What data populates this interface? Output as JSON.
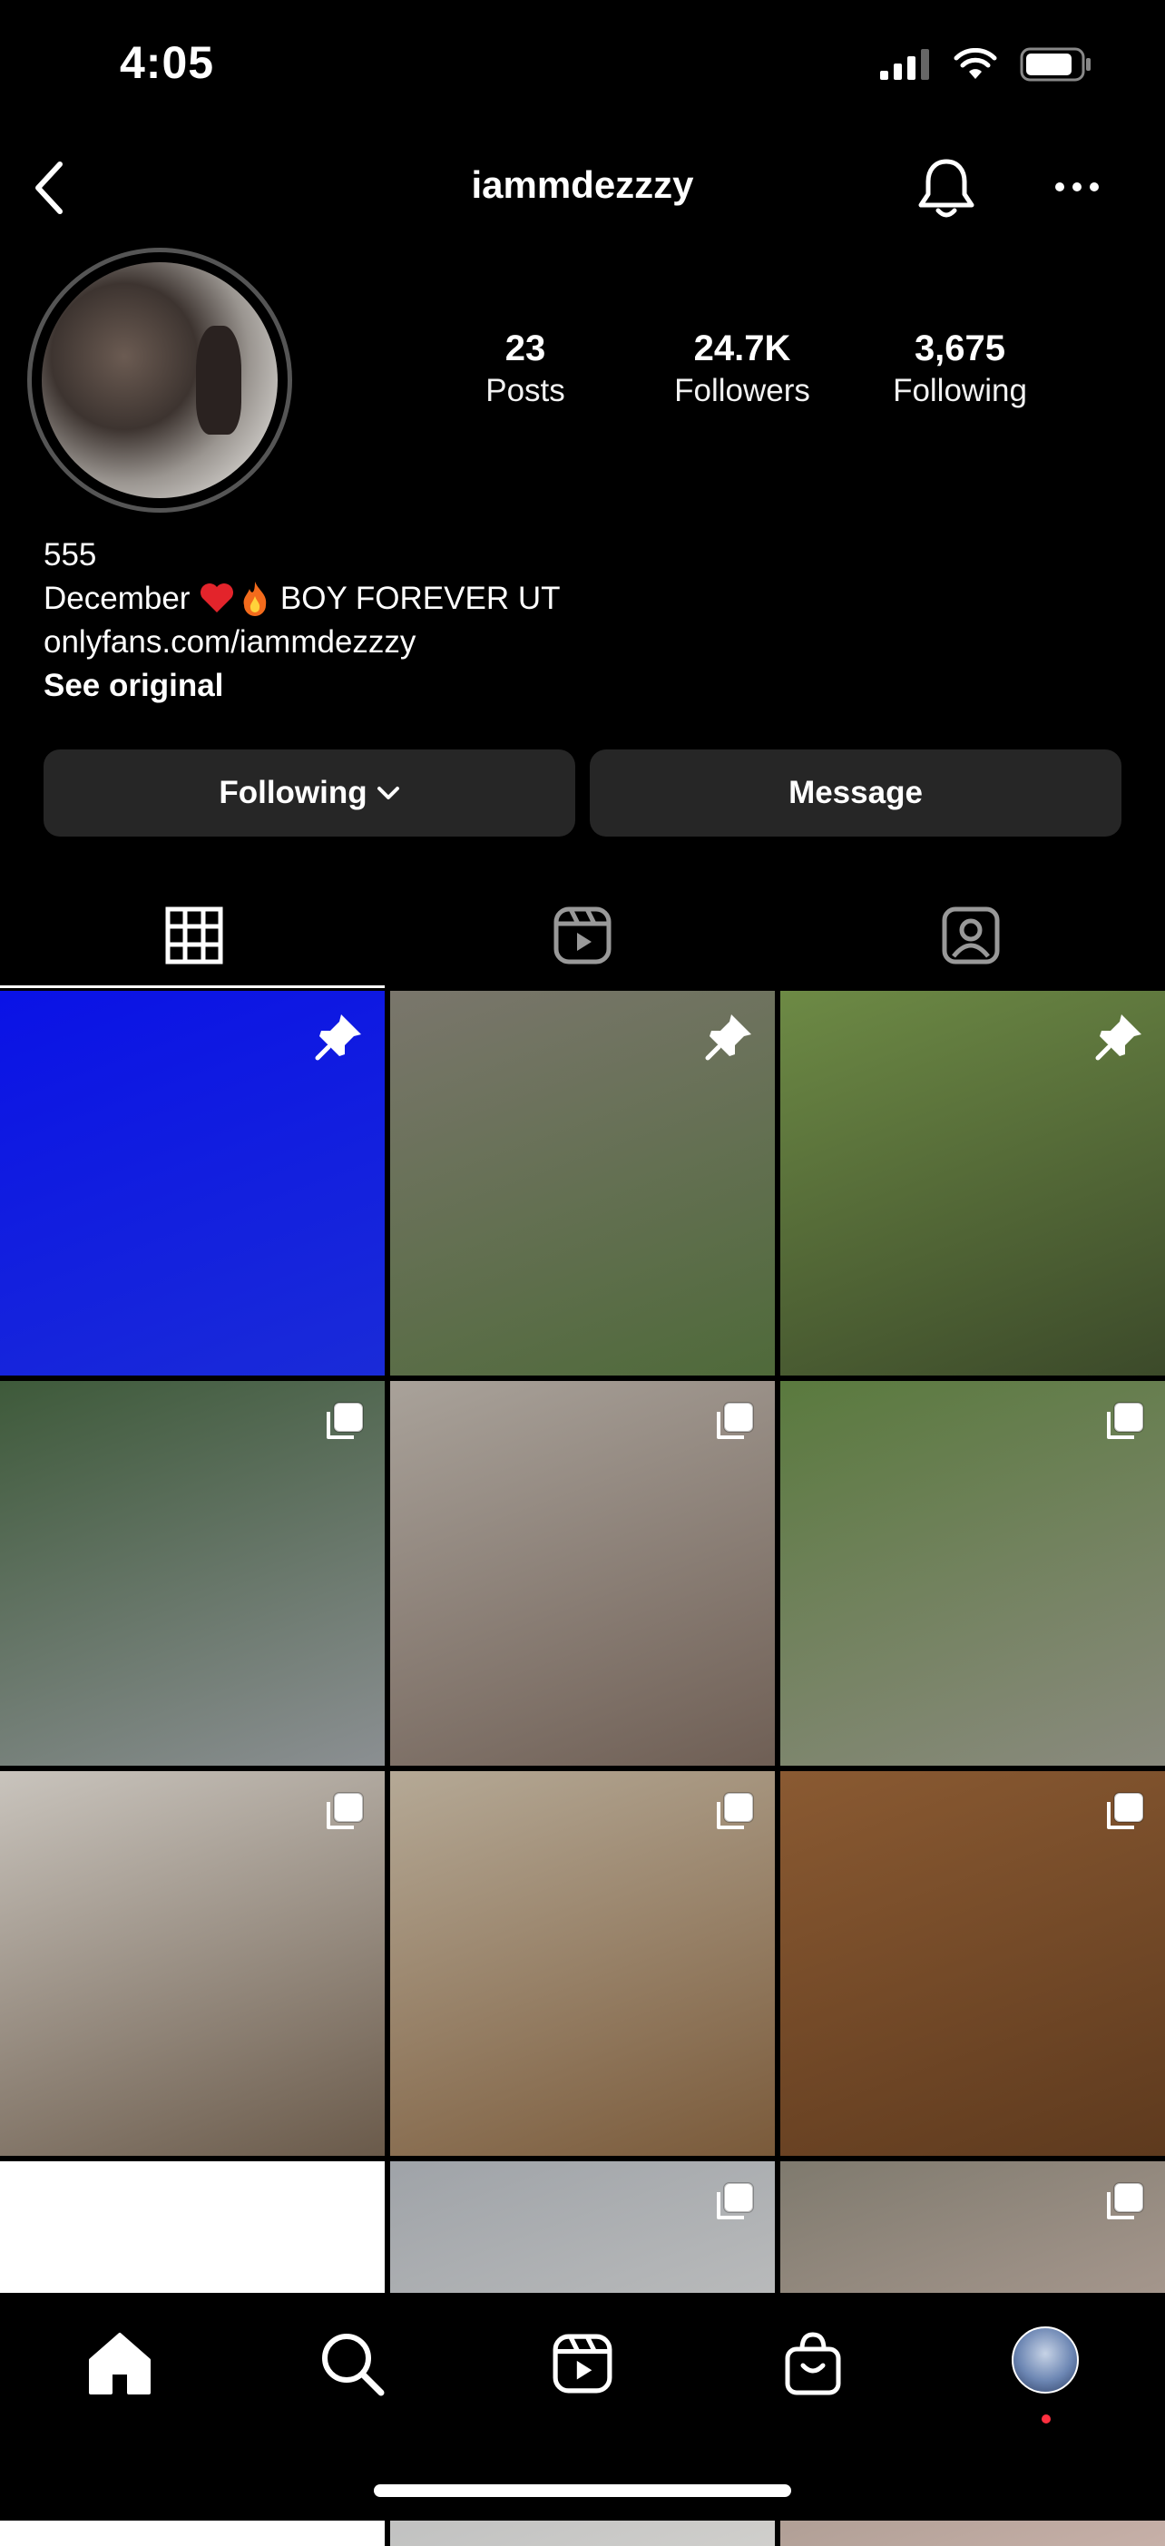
{
  "status_bar": {
    "time": "4:05"
  },
  "header": {
    "username": "iammdezzzy"
  },
  "stats": [
    {
      "value": "23",
      "label": "Posts"
    },
    {
      "value": "24.7K",
      "label": "Followers"
    },
    {
      "value": "3,675",
      "label": "Following"
    }
  ],
  "bio": {
    "name": "555",
    "line1_a": "December ",
    "line1_b": " BOY FOREVER UT",
    "link": "onlyfans.com/iammdezzzy",
    "see_original": "See original"
  },
  "buttons": {
    "following": "Following",
    "message": "Message"
  },
  "tabs": [
    "grid-icon",
    "reels-icon",
    "tagged-icon"
  ],
  "posts": [
    {
      "badge": "pin-icon",
      "colors": [
        "#0a12e6",
        "#1a2bd8"
      ]
    },
    {
      "badge": "pin-icon",
      "colors": [
        "#7a766c",
        "#4f6a3a"
      ]
    },
    {
      "badge": "pin-icon",
      "colors": [
        "#6d8a45",
        "#3c4a2a"
      ]
    },
    {
      "badge": "carousel-icon",
      "colors": [
        "#3e5a3a",
        "#8b8f92"
      ]
    },
    {
      "badge": "carousel-icon",
      "colors": [
        "#a9a29a",
        "#6f5f55"
      ]
    },
    {
      "badge": "carousel-icon",
      "colors": [
        "#5a7a3e",
        "#8a8a7e"
      ]
    },
    {
      "badge": "carousel-icon",
      "colors": [
        "#c9c4bd",
        "#6a5a4a"
      ]
    },
    {
      "badge": "carousel-icon",
      "colors": [
        "#b5a996",
        "#7a5a3a"
      ]
    },
    {
      "badge": "carousel-icon",
      "colors": [
        "#8a5a32",
        "#5e3a1e"
      ]
    },
    {
      "badge": "",
      "colors": [
        "#ffffff",
        "#ffffff"
      ]
    },
    {
      "badge": "carousel-icon",
      "colors": [
        "#9fa3a8",
        "#d0cfcc"
      ]
    },
    {
      "badge": "carousel-icon",
      "colors": [
        "#7f7a6e",
        "#c7b0a8"
      ]
    }
  ],
  "bottom_nav": [
    "home-icon",
    "search-icon",
    "reels-icon",
    "shop-icon",
    "profile-avatar"
  ]
}
